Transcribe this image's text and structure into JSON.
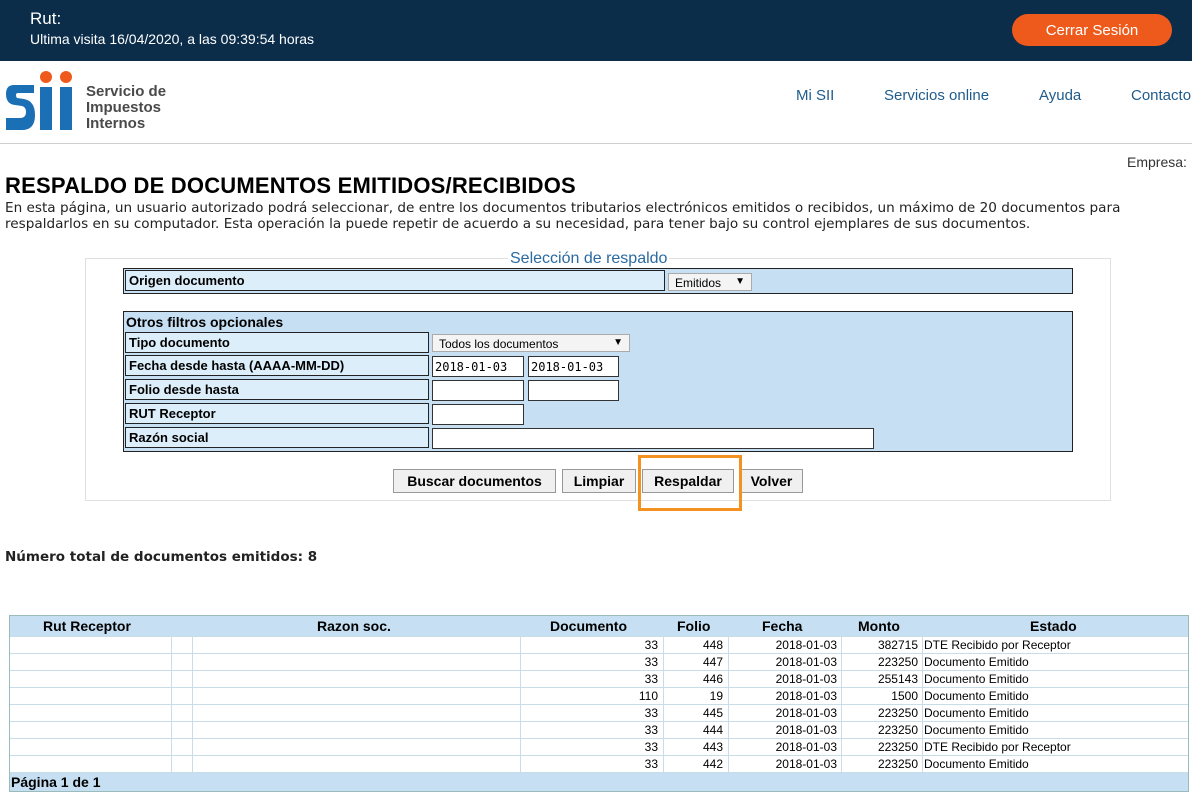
{
  "topbar": {
    "rut_label": "Rut:",
    "last_visit": "Ultima visita 16/04/2020, a las 09:39:54 horas",
    "logout_label": "Cerrar Sesión"
  },
  "logo": {
    "line1": "Servicio de",
    "line2": "Impuestos",
    "line3": "Internos"
  },
  "nav": {
    "items": [
      "Mi SII",
      "Servicios online",
      "Ayuda",
      "Contacto"
    ]
  },
  "empresa_label": "Empresa:",
  "page_title": "RESPALDO DE DOCUMENTOS EMITIDOS/RECIBIDOS",
  "intro": "En esta página, un usuario autorizado podrá seleccionar, de entre los documentos tributarios electrónicos emitidos o recibidos, un máximo de 20 documentos para respaldarlos en su computador. Esta operación la puede repetir de acuerdo a su necesidad, para tener bajo su control ejemplares de sus documentos.",
  "form": {
    "panel_title": "Selección de respaldo",
    "origen_label": "Origen documento",
    "origen_value": "Emitidos",
    "filters_title": "Otros filtros opcionales",
    "tipo_label": "Tipo documento",
    "tipo_value": "Todos los documentos",
    "fecha_label": "Fecha desde hasta (AAAA-MM-DD)",
    "fecha_desde": "2018-01-03",
    "fecha_hasta": "2018-01-03",
    "folio_label": "Folio desde hasta",
    "folio_desde": "",
    "folio_hasta": "",
    "rut_label": "RUT Receptor",
    "rut_value": "",
    "razon_label": "Razón social",
    "razon_value": ""
  },
  "buttons": {
    "buscar": "Buscar documentos",
    "limpiar": "Limpiar",
    "respaldar": "Respaldar",
    "volver": "Volver"
  },
  "total_label": "Número total de documentos emitidos: 8",
  "table": {
    "headers": [
      "Rut Receptor",
      "Razon soc.",
      "Documento",
      "Folio",
      "Fecha",
      "Monto",
      "Estado"
    ],
    "rows": [
      {
        "doc": "33",
        "folio": "448",
        "fecha": "2018-01-03",
        "monto": "382715",
        "estado": "DTE Recibido por Receptor"
      },
      {
        "doc": "33",
        "folio": "447",
        "fecha": "2018-01-03",
        "monto": "223250",
        "estado": "Documento Emitido"
      },
      {
        "doc": "33",
        "folio": "446",
        "fecha": "2018-01-03",
        "monto": "255143",
        "estado": "Documento Emitido"
      },
      {
        "doc": "110",
        "folio": "19",
        "fecha": "2018-01-03",
        "monto": "1500",
        "estado": "Documento Emitido"
      },
      {
        "doc": "33",
        "folio": "445",
        "fecha": "2018-01-03",
        "monto": "223250",
        "estado": "Documento Emitido"
      },
      {
        "doc": "33",
        "folio": "444",
        "fecha": "2018-01-03",
        "monto": "223250",
        "estado": "Documento Emitido"
      },
      {
        "doc": "33",
        "folio": "443",
        "fecha": "2018-01-03",
        "monto": "223250",
        "estado": "DTE Recibido por Receptor"
      },
      {
        "doc": "33",
        "folio": "442",
        "fecha": "2018-01-03",
        "monto": "223250",
        "estado": "Documento Emitido"
      }
    ],
    "footer": "Página 1 de 1"
  },
  "colors": {
    "topbar_bg": "#0b2d4a",
    "logout_bg": "#ee5a1c",
    "brand_blue": "#1a6fb5",
    "brand_orange": "#ee5a1c",
    "form_bg": "#c6dff2",
    "highlight": "#f39221"
  }
}
